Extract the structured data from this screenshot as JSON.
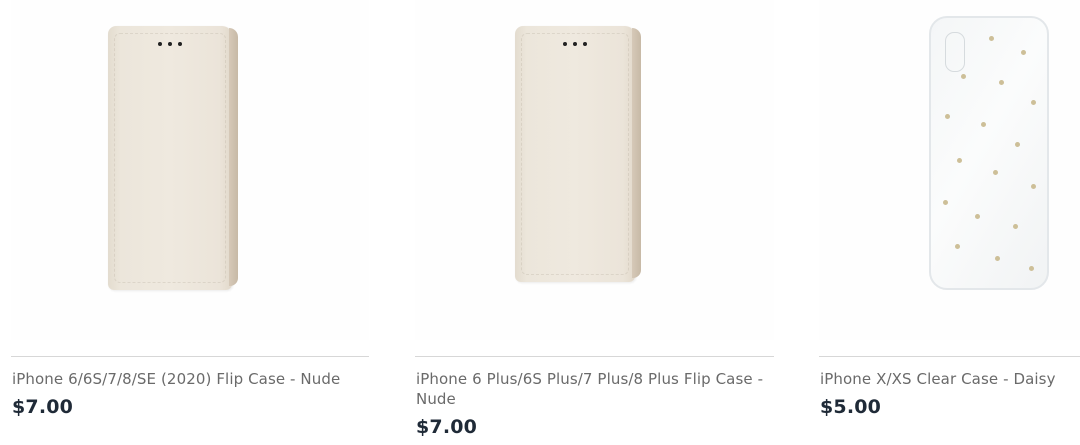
{
  "products": [
    {
      "title": "iPhone 6/6S/7/8/SE (2020) Flip Case - Nude",
      "price": "$7.00",
      "image": "flip-case-nude"
    },
    {
      "title": "iPhone 6 Plus/6S Plus/7 Plus/8 Plus Flip Case - Nude",
      "price": "$7.00",
      "image": "flip-case-nude-plus"
    },
    {
      "title": "iPhone X/XS Clear Case - Daisy",
      "price": "$5.00",
      "image": "clear-case-daisy"
    }
  ],
  "colors": {
    "price": "#1f2a37",
    "title": "#6a6a6a",
    "divider": "#d7d7d7",
    "case_nude": "#ece6db",
    "polka_dot": "#cdbf98"
  }
}
